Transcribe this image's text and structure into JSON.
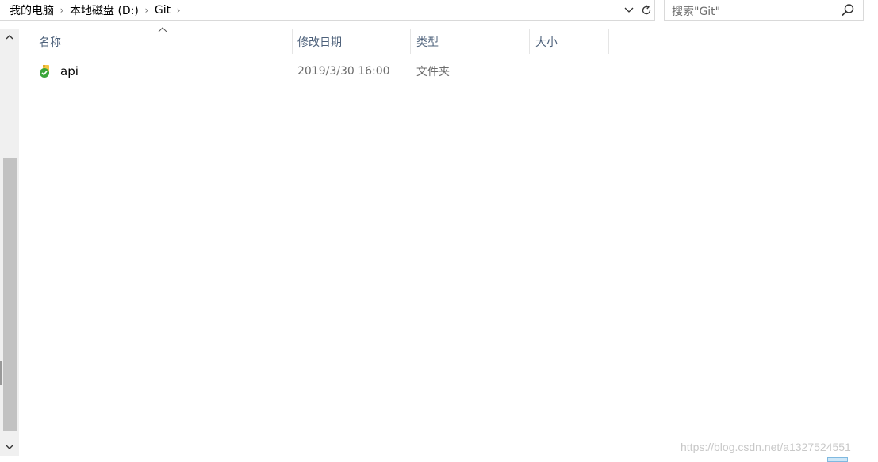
{
  "address": {
    "crumbs": [
      "我的电脑",
      "本地磁盘 (D:)",
      "Git"
    ]
  },
  "search": {
    "placeholder": "搜索\"Git\""
  },
  "columns": {
    "name": "名称",
    "modified": "修改日期",
    "type": "类型",
    "size": "大小"
  },
  "files": [
    {
      "name": "api",
      "modified": "2019/3/30 16:00",
      "type": "文件夹",
      "size": "",
      "icon": "folder-synced-icon"
    }
  ],
  "watermark": "https://blog.csdn.net/a1327524551",
  "colors": {
    "header_text": "#4c607a",
    "scroll_thumb": "#c2c2c2",
    "sync_green": "#3aa53a"
  }
}
